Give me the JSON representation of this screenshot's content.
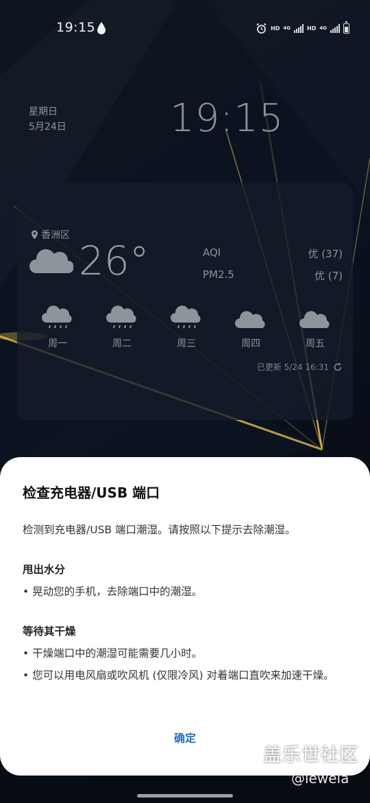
{
  "status_bar": {
    "time": "19:15",
    "hd1": "HD",
    "net1": "4G",
    "hd2": "HD",
    "net2": "4G"
  },
  "lock": {
    "weekday": "星期日",
    "date": "5月24日",
    "clock": "19:15"
  },
  "weather": {
    "location": "香洲区",
    "temperature": "26°",
    "aqi_label": "AQI",
    "aqi_value": "优 (37)",
    "pm_label": "PM2.5",
    "pm_value": "优 (7)",
    "forecast": [
      {
        "day": "周一",
        "icon": "rain-cloud-icon"
      },
      {
        "day": "周二",
        "icon": "rain-cloud-icon"
      },
      {
        "day": "周三",
        "icon": "rain-cloud-icon"
      },
      {
        "day": "周四",
        "icon": "cloud-icon"
      },
      {
        "day": "周五",
        "icon": "cloud-icon"
      }
    ],
    "updated": "已更新 5/24 16:31"
  },
  "dialog": {
    "title": "检查充电器/USB 端口",
    "intro": "检测到充电器/USB 端口潮湿。请按照以下提示去除潮湿。",
    "section1_title": "甩出水分",
    "section1_item1": "• 晃动您的手机，去除端口中的潮湿。",
    "section2_title": "等待其干燥",
    "section2_item1": "• 干燥端口中的潮湿可能需要几小时。",
    "section2_item2": "• 您可以用电风扇或吹风机 (仅限冷风) 对着端口直吹来加速干燥。",
    "ok_label": "确定"
  },
  "watermark": {
    "text": "盖乐世社区",
    "handle": "@lewela"
  },
  "colors": {
    "accent": "#2d6fb8",
    "dialog_bg": "#ffffff"
  }
}
